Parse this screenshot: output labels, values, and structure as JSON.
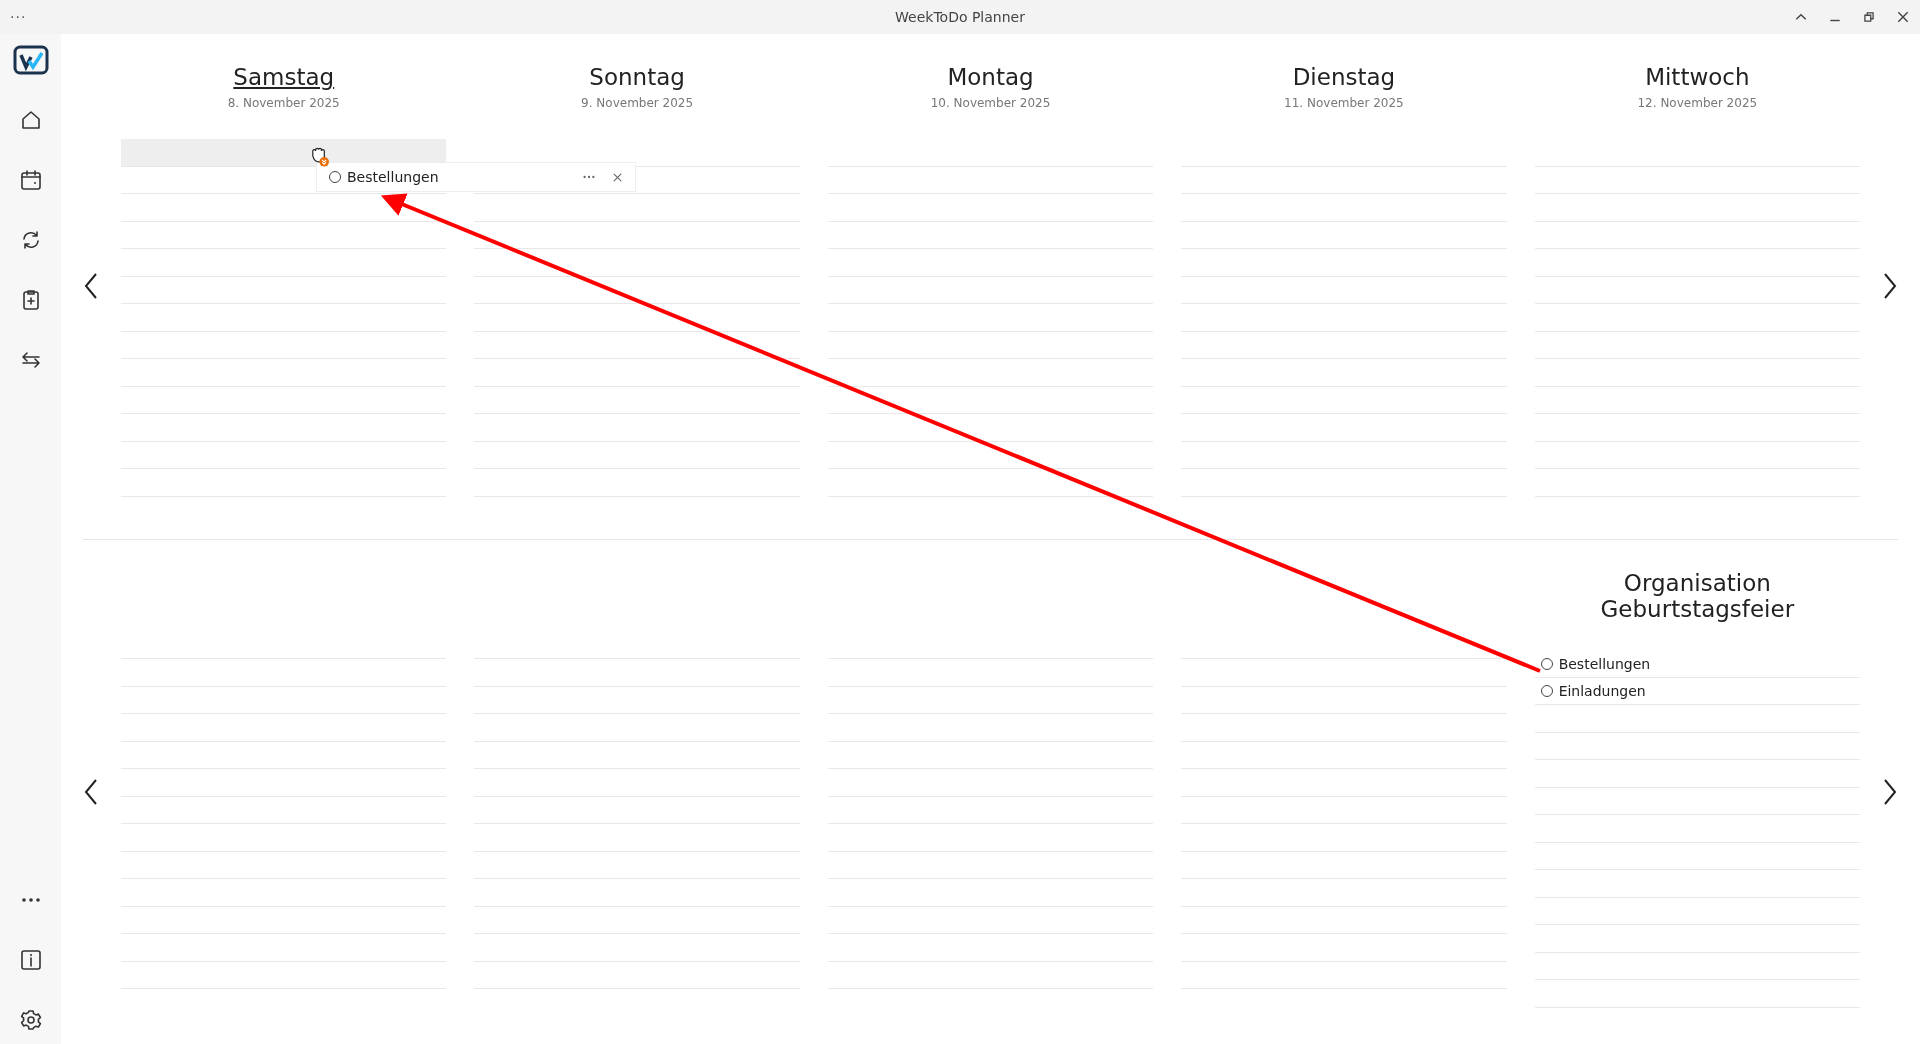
{
  "window": {
    "title": "WeekToDo Planner",
    "menu": "···"
  },
  "sidebar": {
    "items": [
      {
        "kind": "logo"
      },
      {
        "kind": "home"
      },
      {
        "kind": "calendar"
      },
      {
        "kind": "sync"
      },
      {
        "kind": "clipboard"
      },
      {
        "kind": "swap"
      }
    ],
    "bottom_items": [
      {
        "kind": "more"
      },
      {
        "kind": "info"
      },
      {
        "kind": "settings"
      }
    ]
  },
  "week": {
    "days": [
      {
        "name": "Samstag",
        "date": "8. November 2025",
        "today": true,
        "drop_target": true
      },
      {
        "name": "Sonntag",
        "date": "9. November 2025",
        "today": false,
        "drop_target": false
      },
      {
        "name": "Montag",
        "date": "10. November 2025",
        "today": false,
        "drop_target": false
      },
      {
        "name": "Dienstag",
        "date": "11. November 2025",
        "today": false,
        "drop_target": false
      },
      {
        "name": "Mittwoch",
        "date": "12. November 2025",
        "today": false,
        "drop_target": false
      }
    ]
  },
  "drag_preview": {
    "text": "Bestellungen",
    "done": false
  },
  "custom_lists": [
    {
      "kind": "blank"
    },
    {
      "kind": "blank"
    },
    {
      "kind": "blank"
    },
    {
      "kind": "blank"
    },
    {
      "kind": "list",
      "title": "Organisation Geburtstagsfeier",
      "tasks": [
        {
          "text": "Bestellungen",
          "done": false
        },
        {
          "text": "Einladungen",
          "done": false
        }
      ]
    }
  ]
}
